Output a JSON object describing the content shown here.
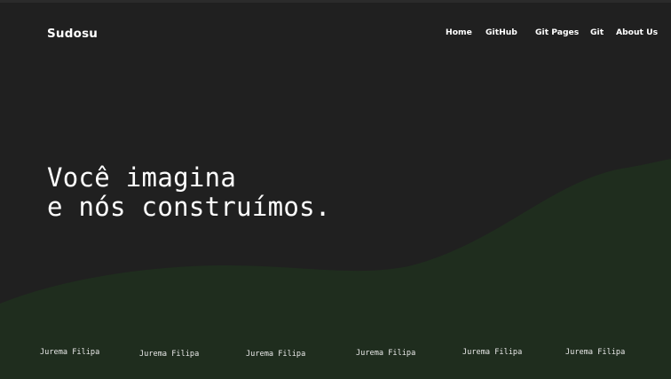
{
  "brand": "Sudosu",
  "nav": {
    "home": "Home",
    "github": "GitHub",
    "git_pages": "Git Pages",
    "git": "Git",
    "about": "About Us"
  },
  "hero": {
    "line1": "Você imagina",
    "line2": "e nós construímos."
  },
  "members": [
    "Jurema Filipa",
    "Jurema Filipa",
    "Jurema Filipa",
    "Jurema Filipa",
    "Jurema Filipa",
    "Jurema Filipa"
  ],
  "colors": {
    "background": "#202020",
    "wave": "#1f2d1e",
    "text": "#ffffff"
  }
}
